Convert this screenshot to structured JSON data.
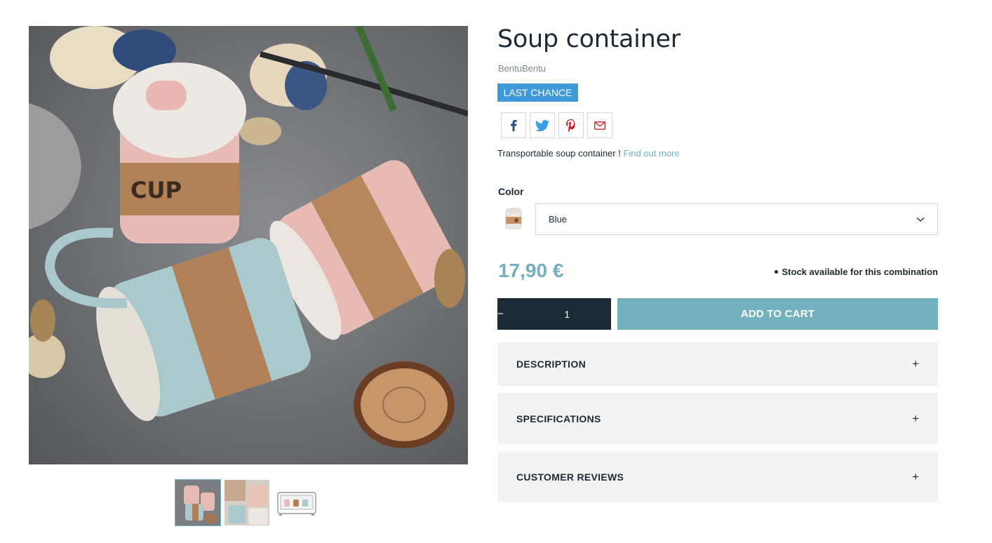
{
  "product": {
    "title": "Soup container",
    "brand": "BentuBentu",
    "badge": "LAST CHANCE",
    "short_description": "Transportable soup container !",
    "find_out_more": "Find out more",
    "price": "17,90 €",
    "stock": "Stock available for this combination"
  },
  "share": {
    "icons": [
      "facebook-icon",
      "twitter-icon",
      "pinterest-icon",
      "email-icon"
    ]
  },
  "variant": {
    "label": "Color",
    "selected": "Blue"
  },
  "cart": {
    "minus": "−",
    "plus": "+",
    "quantity": "1",
    "add_to_cart": "ADD TO CART"
  },
  "accordion": {
    "description": "DESCRIPTION",
    "specifications": "SPECIFICATIONS",
    "reviews": "CUSTOMER REVIEWS",
    "toggle": "+"
  },
  "colors": {
    "accent": "#73b1bf",
    "badge": "#3f98d8",
    "dark": "#1c2a36",
    "panel": "#f3f3f3"
  }
}
